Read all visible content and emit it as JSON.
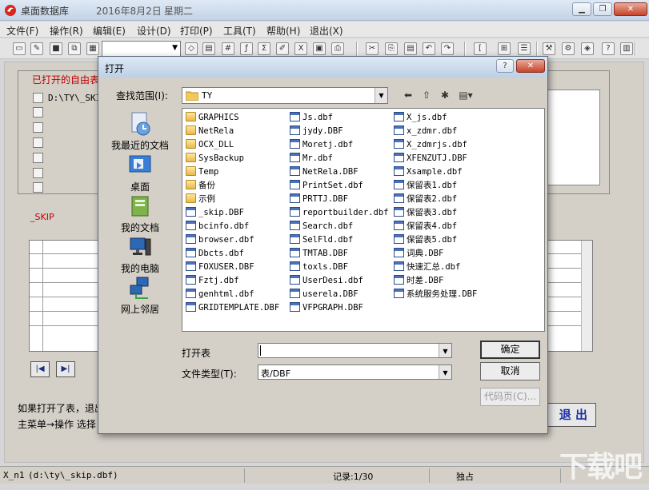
{
  "window": {
    "title": "桌面数据库",
    "date": "2016年8月2日",
    "weekday": "星期二"
  },
  "menu": [
    "文件(F)",
    "操作(R)",
    "编辑(E)",
    "设计(D)",
    "打印(P)",
    "工具(T)",
    "帮助(H)",
    "退出(X)"
  ],
  "main": {
    "opened_label": "已打开的自由表",
    "opened_path": "D:\\TY\\_SKIP",
    "skip_label": "_SKIP",
    "hint_line1": "如果打开了表，退出",
    "hint_line2": "主菜单→操作 选择",
    "exit_label": "退 出"
  },
  "status": {
    "alias": "X_n1",
    "path": "(d:\\ty\\_skip.dbf)",
    "record": "记录:1/30",
    "mode": "独占"
  },
  "dialog": {
    "title": "打开",
    "lookin_label": "查找范围(I):",
    "lookin_value": "TY",
    "places": [
      "我最近的文档",
      "桌面",
      "我的文档",
      "我的电脑",
      "网上邻居"
    ],
    "columns": [
      [
        {
          "name": "GRAPHICS",
          "type": "folder"
        },
        {
          "name": "NetRela",
          "type": "folder"
        },
        {
          "name": "OCX_DLL",
          "type": "folder"
        },
        {
          "name": "SysBackup",
          "type": "folder"
        },
        {
          "name": "Temp",
          "type": "folder"
        },
        {
          "name": "备份",
          "type": "folder"
        },
        {
          "name": "示例",
          "type": "folder"
        },
        {
          "name": "_skip.DBF",
          "type": "dbf"
        },
        {
          "name": "bcinfo.dbf",
          "type": "dbf"
        },
        {
          "name": "browser.dbf",
          "type": "dbf"
        },
        {
          "name": "Dbcts.dbf",
          "type": "dbf"
        },
        {
          "name": "FOXUSER.DBF",
          "type": "dbf"
        },
        {
          "name": "Fztj.dbf",
          "type": "dbf"
        },
        {
          "name": "genhtml.dbf",
          "type": "dbf"
        },
        {
          "name": "GRIDTEMPLATE.DBF",
          "type": "dbf"
        }
      ],
      [
        {
          "name": "Js.dbf",
          "type": "dbf"
        },
        {
          "name": "jydy.DBF",
          "type": "dbf"
        },
        {
          "name": "Moretj.dbf",
          "type": "dbf"
        },
        {
          "name": "Mr.dbf",
          "type": "dbf"
        },
        {
          "name": "NetRela.DBF",
          "type": "dbf"
        },
        {
          "name": "PrintSet.dbf",
          "type": "dbf"
        },
        {
          "name": "PRTTJ.DBF",
          "type": "dbf"
        },
        {
          "name": "reportbuilder.dbf",
          "type": "dbf"
        },
        {
          "name": "Search.dbf",
          "type": "dbf"
        },
        {
          "name": "SelFld.dbf",
          "type": "dbf"
        },
        {
          "name": "TMTAB.DBF",
          "type": "dbf"
        },
        {
          "name": "toxls.DBF",
          "type": "dbf"
        },
        {
          "name": "UserDesi.dbf",
          "type": "dbf"
        },
        {
          "name": "userela.DBF",
          "type": "dbf"
        },
        {
          "name": "VFPGRAPH.DBF",
          "type": "dbf"
        }
      ],
      [
        {
          "name": "X_js.dbf",
          "type": "dbf"
        },
        {
          "name": "x_zdmr.dbf",
          "type": "dbf"
        },
        {
          "name": "X_zdmrjs.dbf",
          "type": "dbf"
        },
        {
          "name": "XFENZUTJ.DBF",
          "type": "dbf"
        },
        {
          "name": "Xsample.dbf",
          "type": "dbf"
        },
        {
          "name": "保留表1.dbf",
          "type": "dbf"
        },
        {
          "name": "保留表2.dbf",
          "type": "dbf"
        },
        {
          "name": "保留表3.dbf",
          "type": "dbf"
        },
        {
          "name": "保留表4.dbf",
          "type": "dbf"
        },
        {
          "name": "保留表5.dbf",
          "type": "dbf"
        },
        {
          "name": "词典.DBF",
          "type": "dbf"
        },
        {
          "name": "快速汇总.dbf",
          "type": "dbf"
        },
        {
          "name": "时差.DBF",
          "type": "dbf"
        },
        {
          "name": "系统服务处理.DBF",
          "type": "dbf"
        }
      ]
    ],
    "openfile_label": "打开表",
    "openfile_value": "",
    "filetype_label": "文件类型(T):",
    "filetype_value": "表/DBF",
    "ok_label": "确定",
    "cancel_label": "取消",
    "codepage_label": "代码页(C)..."
  },
  "watermark": "下载吧"
}
